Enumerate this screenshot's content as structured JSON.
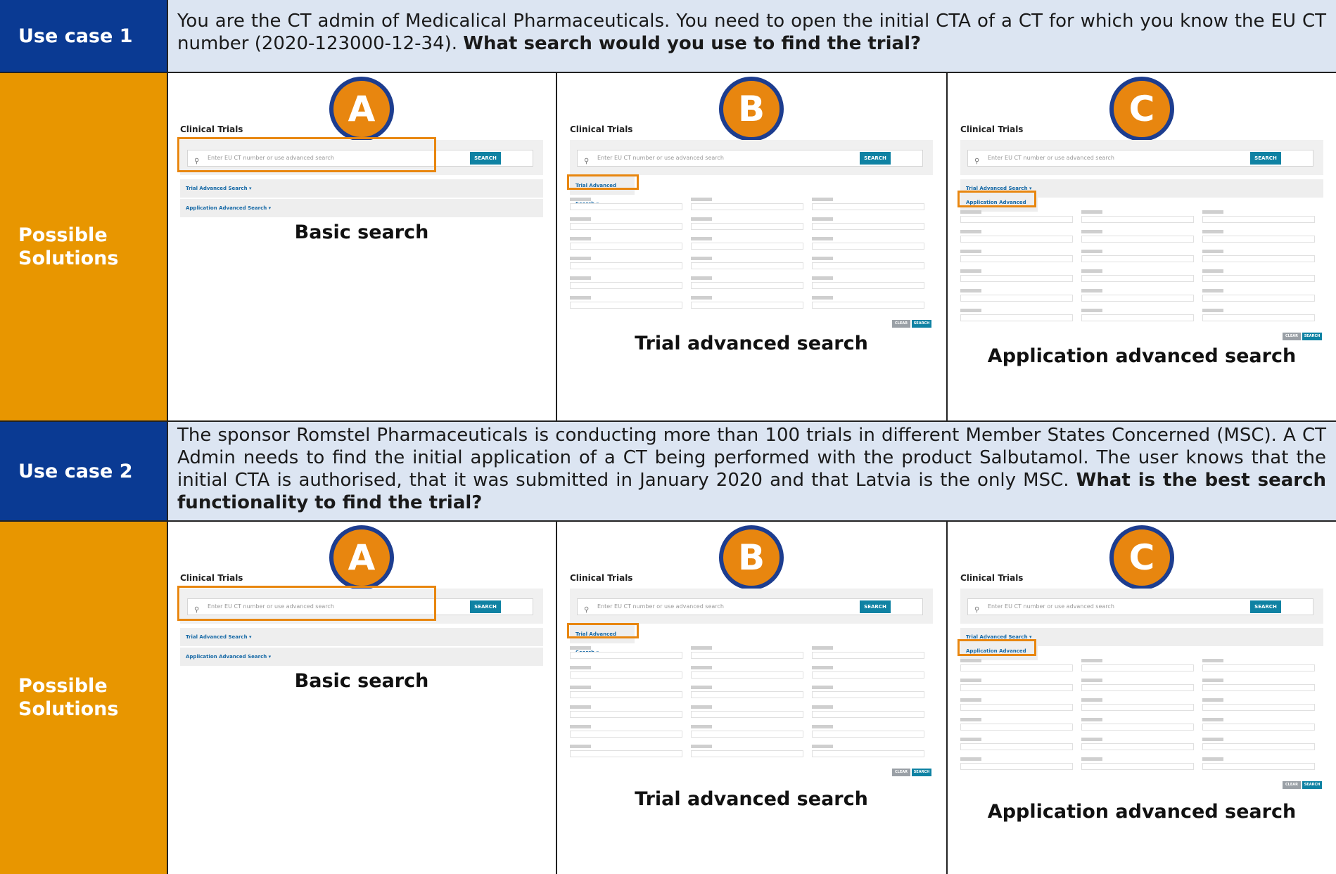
{
  "rows": {
    "use_case_1": {
      "label": "Use case 1",
      "text": "You are the CT admin of Medicalical Pharmaceuticals. You need to open the initial CTA of a CT for which you know the EU CT number (2020-123000-12-34).",
      "question": "What search would you use to find the trial?"
    },
    "solutions_1": {
      "label_line1": "Possible",
      "label_line2": "Solutions"
    },
    "use_case_2": {
      "label": "Use case 2",
      "text": "The sponsor Romstel Pharmaceuticals is conducting more than 100 trials in different Member States Concerned (MSC). A CT Admin needs to find the initial application of a CT being performed with the product Salbutamol. The user knows that the initial CTA is authorised, that it was submitted in January 2020 and that Latvia is the only MSC.",
      "question": "What is the best search functionality to find the trial?"
    },
    "solutions_2": {
      "label_line1": "Possible",
      "label_line2": "Solutions"
    }
  },
  "options": {
    "a": {
      "badge": "A",
      "caption": "Basic search"
    },
    "b": {
      "badge": "B",
      "caption": "Trial advanced search"
    },
    "c": {
      "badge": "C",
      "caption": "Application advanced search"
    }
  },
  "screenshot": {
    "title": "Clinical Trials",
    "placeholder": "Enter EU CT number or use advanced search",
    "search_button": "SEARCH",
    "clear_button": "CLEAR",
    "trial_adv": "Trial Advanced Search ▾",
    "app_adv": "Application Advanced Search ▾"
  },
  "colors": {
    "navy": "#0a3a93",
    "orange": "#e89600",
    "light_blue": "#dce5f2",
    "highlight": "#e8860f"
  }
}
